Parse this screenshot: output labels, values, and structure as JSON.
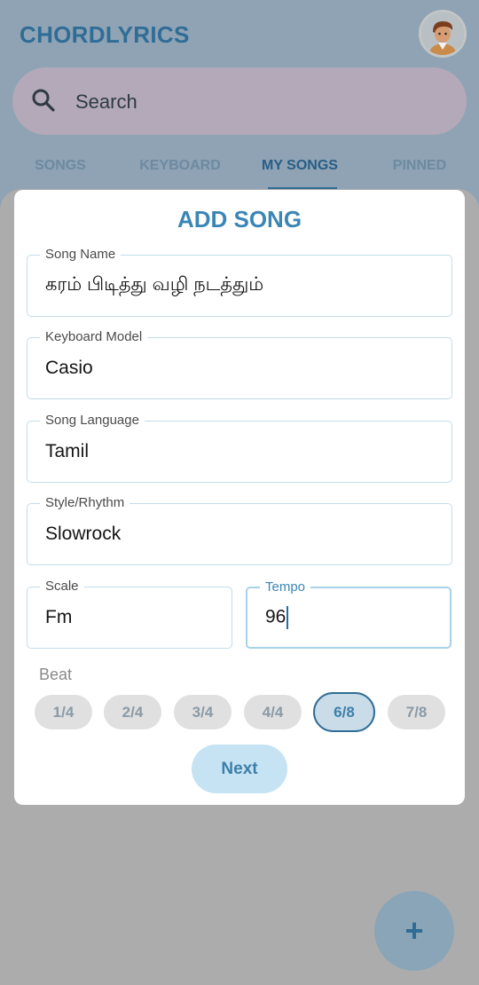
{
  "app": {
    "title": "CHORDLYRICS"
  },
  "search": {
    "placeholder": "Search"
  },
  "tabs": [
    {
      "label": "SONGS"
    },
    {
      "label": "KEYBOARD"
    },
    {
      "label": "MY SONGS",
      "active": true
    },
    {
      "label": "PINNED"
    }
  ],
  "dialog": {
    "title": "ADD SONG",
    "fields": {
      "song_name": {
        "label": "Song Name",
        "value": "கரம் பிடித்து வழி நடத்தும்"
      },
      "keyboard_model": {
        "label": "Keyboard Model",
        "value": "Casio"
      },
      "song_language": {
        "label": "Song Language",
        "value": "Tamil"
      },
      "style_rhythm": {
        "label": "Style/Rhythm",
        "value": "Slowrock"
      },
      "scale": {
        "label": "Scale",
        "value": "Fm"
      },
      "tempo": {
        "label": "Tempo",
        "value": "96"
      }
    },
    "beat": {
      "label": "Beat",
      "options": [
        "1/4",
        "2/4",
        "3/4",
        "4/4",
        "6/8",
        "7/8"
      ],
      "selected": "6/8"
    },
    "next_label": "Next"
  },
  "fab": {
    "icon": "plus-icon"
  },
  "colors": {
    "accent": "#3b86b5",
    "selected_border": "#2f6d97"
  }
}
